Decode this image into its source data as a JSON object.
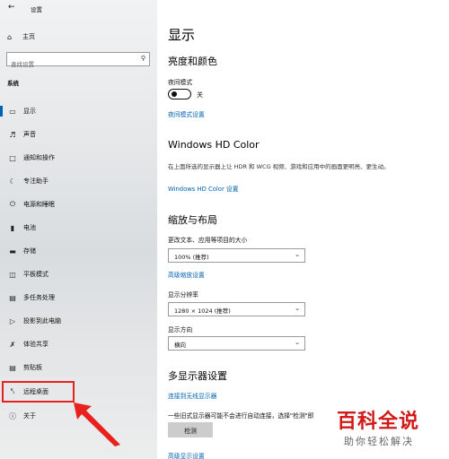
{
  "window": {
    "title": "设置",
    "back_icon": "back-arrow-icon"
  },
  "sidebar": {
    "home_label": "主页",
    "search_placeholder": "查找设置",
    "section_label": "系统",
    "items": [
      {
        "label": "显示",
        "icon": "monitor-icon",
        "selected": true
      },
      {
        "label": "声音",
        "icon": "speaker-icon"
      },
      {
        "label": "通知和操作",
        "icon": "notification-icon"
      },
      {
        "label": "专注助手",
        "icon": "moon-icon"
      },
      {
        "label": "电源和睡眠",
        "icon": "power-icon"
      },
      {
        "label": "电池",
        "icon": "battery-icon"
      },
      {
        "label": "存储",
        "icon": "storage-icon"
      },
      {
        "label": "平板模式",
        "icon": "tablet-icon"
      },
      {
        "label": "多任务处理",
        "icon": "multitask-icon"
      },
      {
        "label": "投影到此电脑",
        "icon": "project-icon"
      },
      {
        "label": "体验共享",
        "icon": "share-icon"
      },
      {
        "label": "剪贴板",
        "icon": "clipboard-icon"
      },
      {
        "label": "远程桌面",
        "icon": "remote-desktop-icon"
      },
      {
        "label": "关于",
        "icon": "info-icon"
      }
    ],
    "highlight_color": "#e8211f"
  },
  "main": {
    "page_title": "显示",
    "brightness": {
      "heading": "亮度和颜色",
      "night_mode_label": "夜间模式",
      "night_mode_state": "关",
      "night_mode_link": "夜间模式设置"
    },
    "hdr": {
      "heading": "Windows HD Color",
      "description": "在上面所选的显示器上让 HDR 和 WCG 视频、游戏和应用中的画面更明亮、更生动。",
      "link": "Windows HD Color 设置"
    },
    "scale": {
      "heading": "缩放与布局",
      "scale_label": "更改文本、应用等项目的大小",
      "scale_value": "100% (推荐)",
      "advanced_link": "高级缩放设置",
      "resolution_label": "显示分辨率",
      "resolution_value": "1280 × 1024 (推荐)",
      "orientation_label": "显示方向",
      "orientation_value": "横向"
    },
    "multi": {
      "heading": "多显示器设置",
      "wireless_link": "连接到无线显示器",
      "note": "一些旧式显示器可能不会进行自动连接，选择\"检测\"即",
      "detect_button": "检测",
      "advanced_link": "高级显示设置"
    }
  },
  "watermark": {
    "title": "百科全说",
    "subtitle": "助你轻松解决"
  },
  "colors": {
    "accent": "#0063b1",
    "link": "#0063b1",
    "watermark": "#d11919"
  }
}
